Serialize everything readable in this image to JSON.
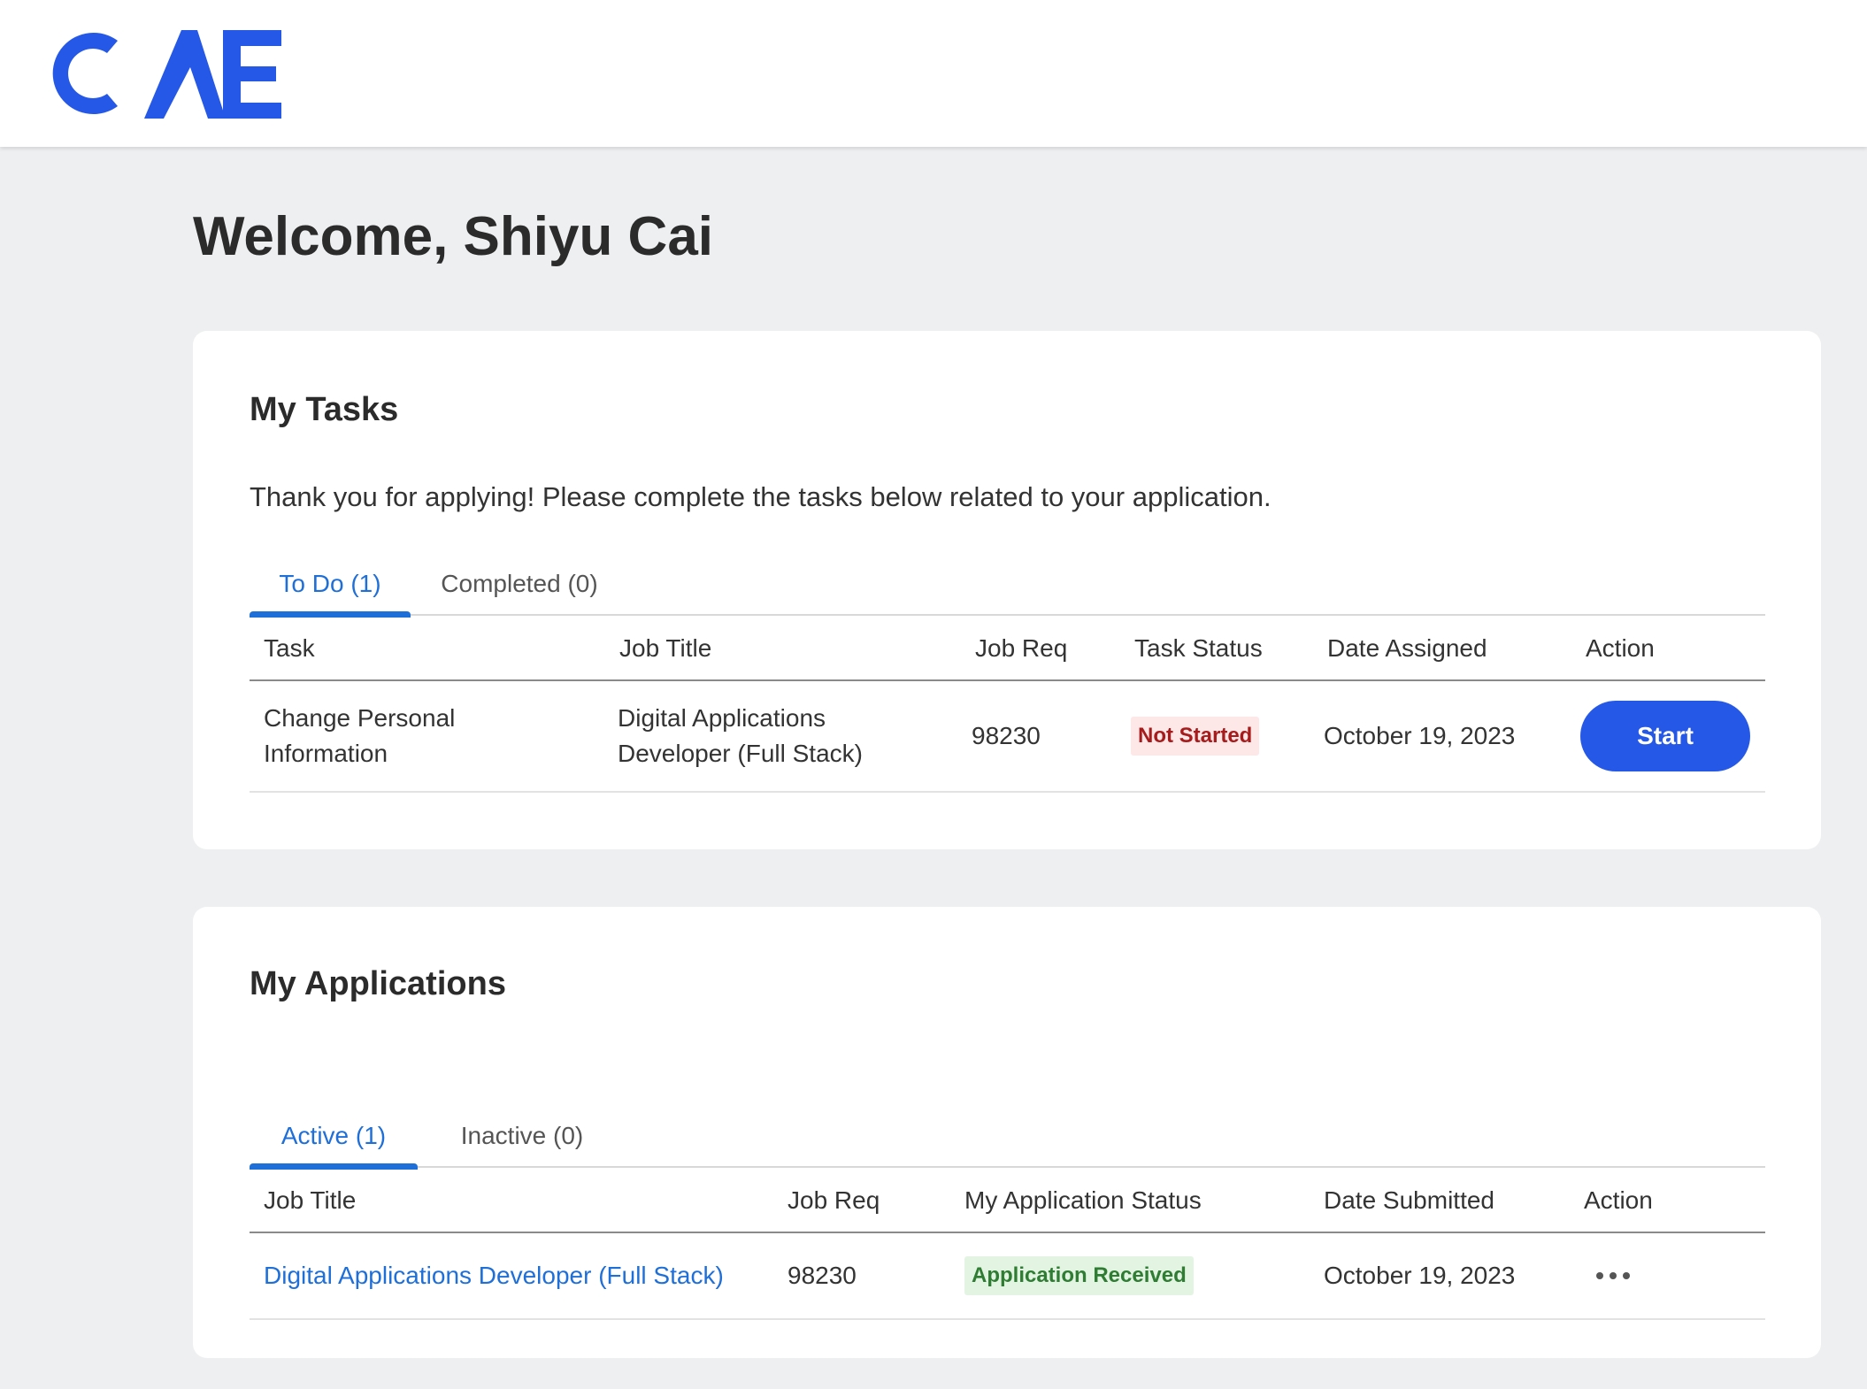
{
  "header": {
    "logo_text": "CAE",
    "logo_color": "#2558e6"
  },
  "welcome": "Welcome, Shiyu Cai",
  "tasks": {
    "title": "My Tasks",
    "intro": "Thank you for applying! Please complete the tasks below related to your application.",
    "tabs": [
      {
        "label": "To Do (1)",
        "active": true
      },
      {
        "label": "Completed (0)",
        "active": false
      }
    ],
    "columns": [
      "Task",
      "Job Title",
      "Job Req",
      "Task Status",
      "Date Assigned",
      "Action"
    ],
    "rows": [
      {
        "task_line1": "Change Personal",
        "task_line2": "Information",
        "job_title_line1": "Digital Applications",
        "job_title_line2": "Developer (Full Stack)",
        "job_req": "98230",
        "status": "Not Started",
        "date": "October 19, 2023",
        "action": "Start"
      }
    ]
  },
  "applications": {
    "title": "My Applications",
    "tabs": [
      {
        "label": "Active (1)",
        "active": true
      },
      {
        "label": "Inactive (0)",
        "active": false
      }
    ],
    "columns": [
      "Job Title",
      "Job Req",
      "My Application Status",
      "Date Submitted",
      "Action"
    ],
    "rows": [
      {
        "job_title": "Digital Applications Developer (Full Stack)",
        "job_req": "98230",
        "status": "Application Received",
        "date": "October 19, 2023",
        "action_icon": "more-horizontal-icon"
      }
    ]
  },
  "colors": {
    "accent": "#1f6fd8",
    "button": "#2558e6",
    "badge_red": "#a61b1b",
    "badge_green": "#2e7d32"
  }
}
